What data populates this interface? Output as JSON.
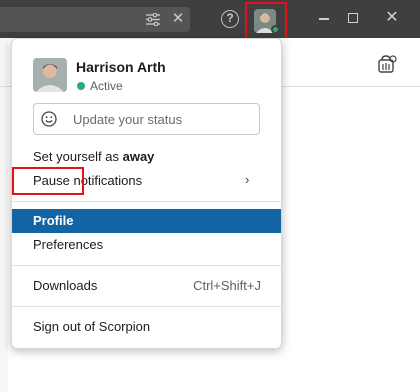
{
  "titlebar": {
    "icons": {
      "search_filter": "sliders-icon",
      "search_clear": "close-icon",
      "help": "help-icon",
      "minimize": "minimize-icon",
      "maximize": "maximize-icon",
      "close": "close-icon"
    },
    "help_glyph": "?",
    "clear_glyph": "✕",
    "close_glyph": "✕"
  },
  "user": {
    "name": "Harrison Arth",
    "status": "Active",
    "status_color": "#2bac76"
  },
  "status_input": {
    "placeholder": "Update your status"
  },
  "menu": {
    "set_away_prefix": "Set yourself as ",
    "set_away_bold": "away",
    "pause_notifications": "Pause notifications",
    "pause_chevron": "›",
    "profile": "Profile",
    "preferences": "Preferences",
    "downloads": "Downloads",
    "downloads_shortcut": "Ctrl+Shift+J",
    "sign_out": "Sign out of Scorpion",
    "highlight_color": "#1264a3"
  }
}
